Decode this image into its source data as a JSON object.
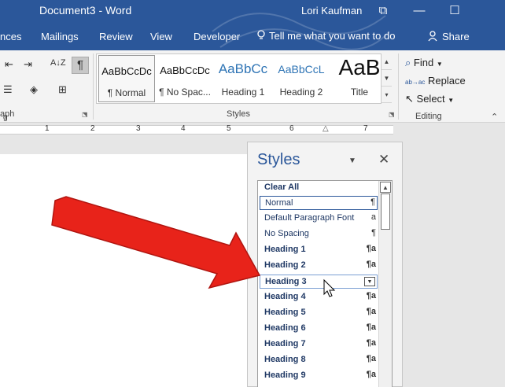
{
  "window": {
    "doc_title": "Document3 - Word",
    "user": "Lori Kaufman",
    "btn_restore": "⧉",
    "btn_minimize": "—",
    "btn_maximize": "☐"
  },
  "tabs": [
    "nces",
    "Mailings",
    "Review",
    "View",
    "Developer"
  ],
  "tell_me": "Tell me what you want to do",
  "share": "Share",
  "ribbon": {
    "paragraph_label": "aph",
    "styles_label": "Styles",
    "editing_label": "Editing",
    "find": "Find",
    "replace": "Replace",
    "select": "Select",
    "gallery": [
      {
        "preview": "AaBbCcDc",
        "name": "¶ Normal"
      },
      {
        "preview": "AaBbCcDc",
        "name": "¶ No Spac..."
      },
      {
        "preview": "AaBbCc",
        "name": "Heading 1"
      },
      {
        "preview": "AaBbCcL",
        "name": "Heading 2"
      },
      {
        "preview": "AaB",
        "name": "Title"
      }
    ]
  },
  "ruler": {
    "numbers": [
      "1",
      "2",
      "3",
      "4",
      "5",
      "6",
      "7"
    ],
    "start": "g"
  },
  "styles_pane": {
    "title": "Styles",
    "menu_icon": "▼",
    "close_icon": "✕",
    "items": [
      {
        "label": "Clear All",
        "mark": ""
      },
      {
        "label": "Normal",
        "mark": "¶"
      },
      {
        "label": "Default Paragraph Font",
        "mark": "a"
      },
      {
        "label": "No Spacing",
        "mark": "¶"
      },
      {
        "label": "Heading 1",
        "mark": "¶a"
      },
      {
        "label": "Heading 2",
        "mark": "¶a"
      },
      {
        "label": "Heading 3",
        "mark": "▼"
      },
      {
        "label": "Heading 4",
        "mark": "¶a"
      },
      {
        "label": "Heading 5",
        "mark": "¶a"
      },
      {
        "label": "Heading 6",
        "mark": "¶a"
      },
      {
        "label": "Heading 7",
        "mark": "¶a"
      },
      {
        "label": "Heading 8",
        "mark": "¶a"
      },
      {
        "label": "Heading 9",
        "mark": "¶a"
      }
    ]
  },
  "colors": {
    "accent": "#2b579a",
    "arrow": "#e8231a"
  },
  "icons": {
    "sort": "A↓Z",
    "pilcrow": "¶",
    "find": "⌕",
    "replace": "ab→ac",
    "select": "↖",
    "up": "▲",
    "down": "▼",
    "more": "▾",
    "launcher": "⬔",
    "collapse": "⌃"
  }
}
